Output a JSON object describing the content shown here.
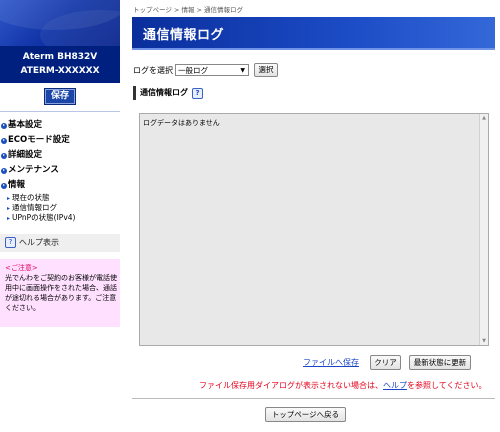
{
  "sidebar": {
    "model_line1": "Aterm  BH832V",
    "model_line2": "ATERM-XXXXXX",
    "save_label": "保存",
    "nav": [
      {
        "label": "基本設定"
      },
      {
        "label": "ECOモード設定"
      },
      {
        "label": "詳細設定"
      },
      {
        "label": "メンテナンス"
      },
      {
        "label": "情報"
      }
    ],
    "sub_items": [
      {
        "label": "現在の状態"
      },
      {
        "label": "通信情報ログ"
      },
      {
        "label": "UPnPの状態(IPv4)"
      }
    ],
    "help_label": "ヘルプ表示",
    "help_icon": "?",
    "notice_title": "<ご注意>",
    "notice_body": "光でんわをご契約のお客様が電話使用中に画面操作をされた場合、通話が途切れる場合があります。ご注意ください。"
  },
  "breadcrumb": {
    "text": "トップページ > 情報 > 通信情報ログ"
  },
  "page": {
    "title": "通信情報ログ",
    "log_select_label": "ログを選択",
    "log_select_value": "一般ログ",
    "select_button": "選択",
    "section_title": "通信情報ログ",
    "log_text": "ログデータはありません",
    "save_file_link": "ファイルへ保存",
    "clear_button": "クリア",
    "refresh_button": "最新状態に更新",
    "warning_before": "ファイル保存用ダイアログが表示されない場合は、",
    "warning_link": "ヘルプ",
    "warning_after": "を参照してください。",
    "back_top_button": "トップページへ戻る"
  },
  "colors": {
    "banner_blue": "#1c4cc6",
    "model_bg": "#002080",
    "warning_red": "#e4001b",
    "notice_pink": "#ffe0ff"
  }
}
